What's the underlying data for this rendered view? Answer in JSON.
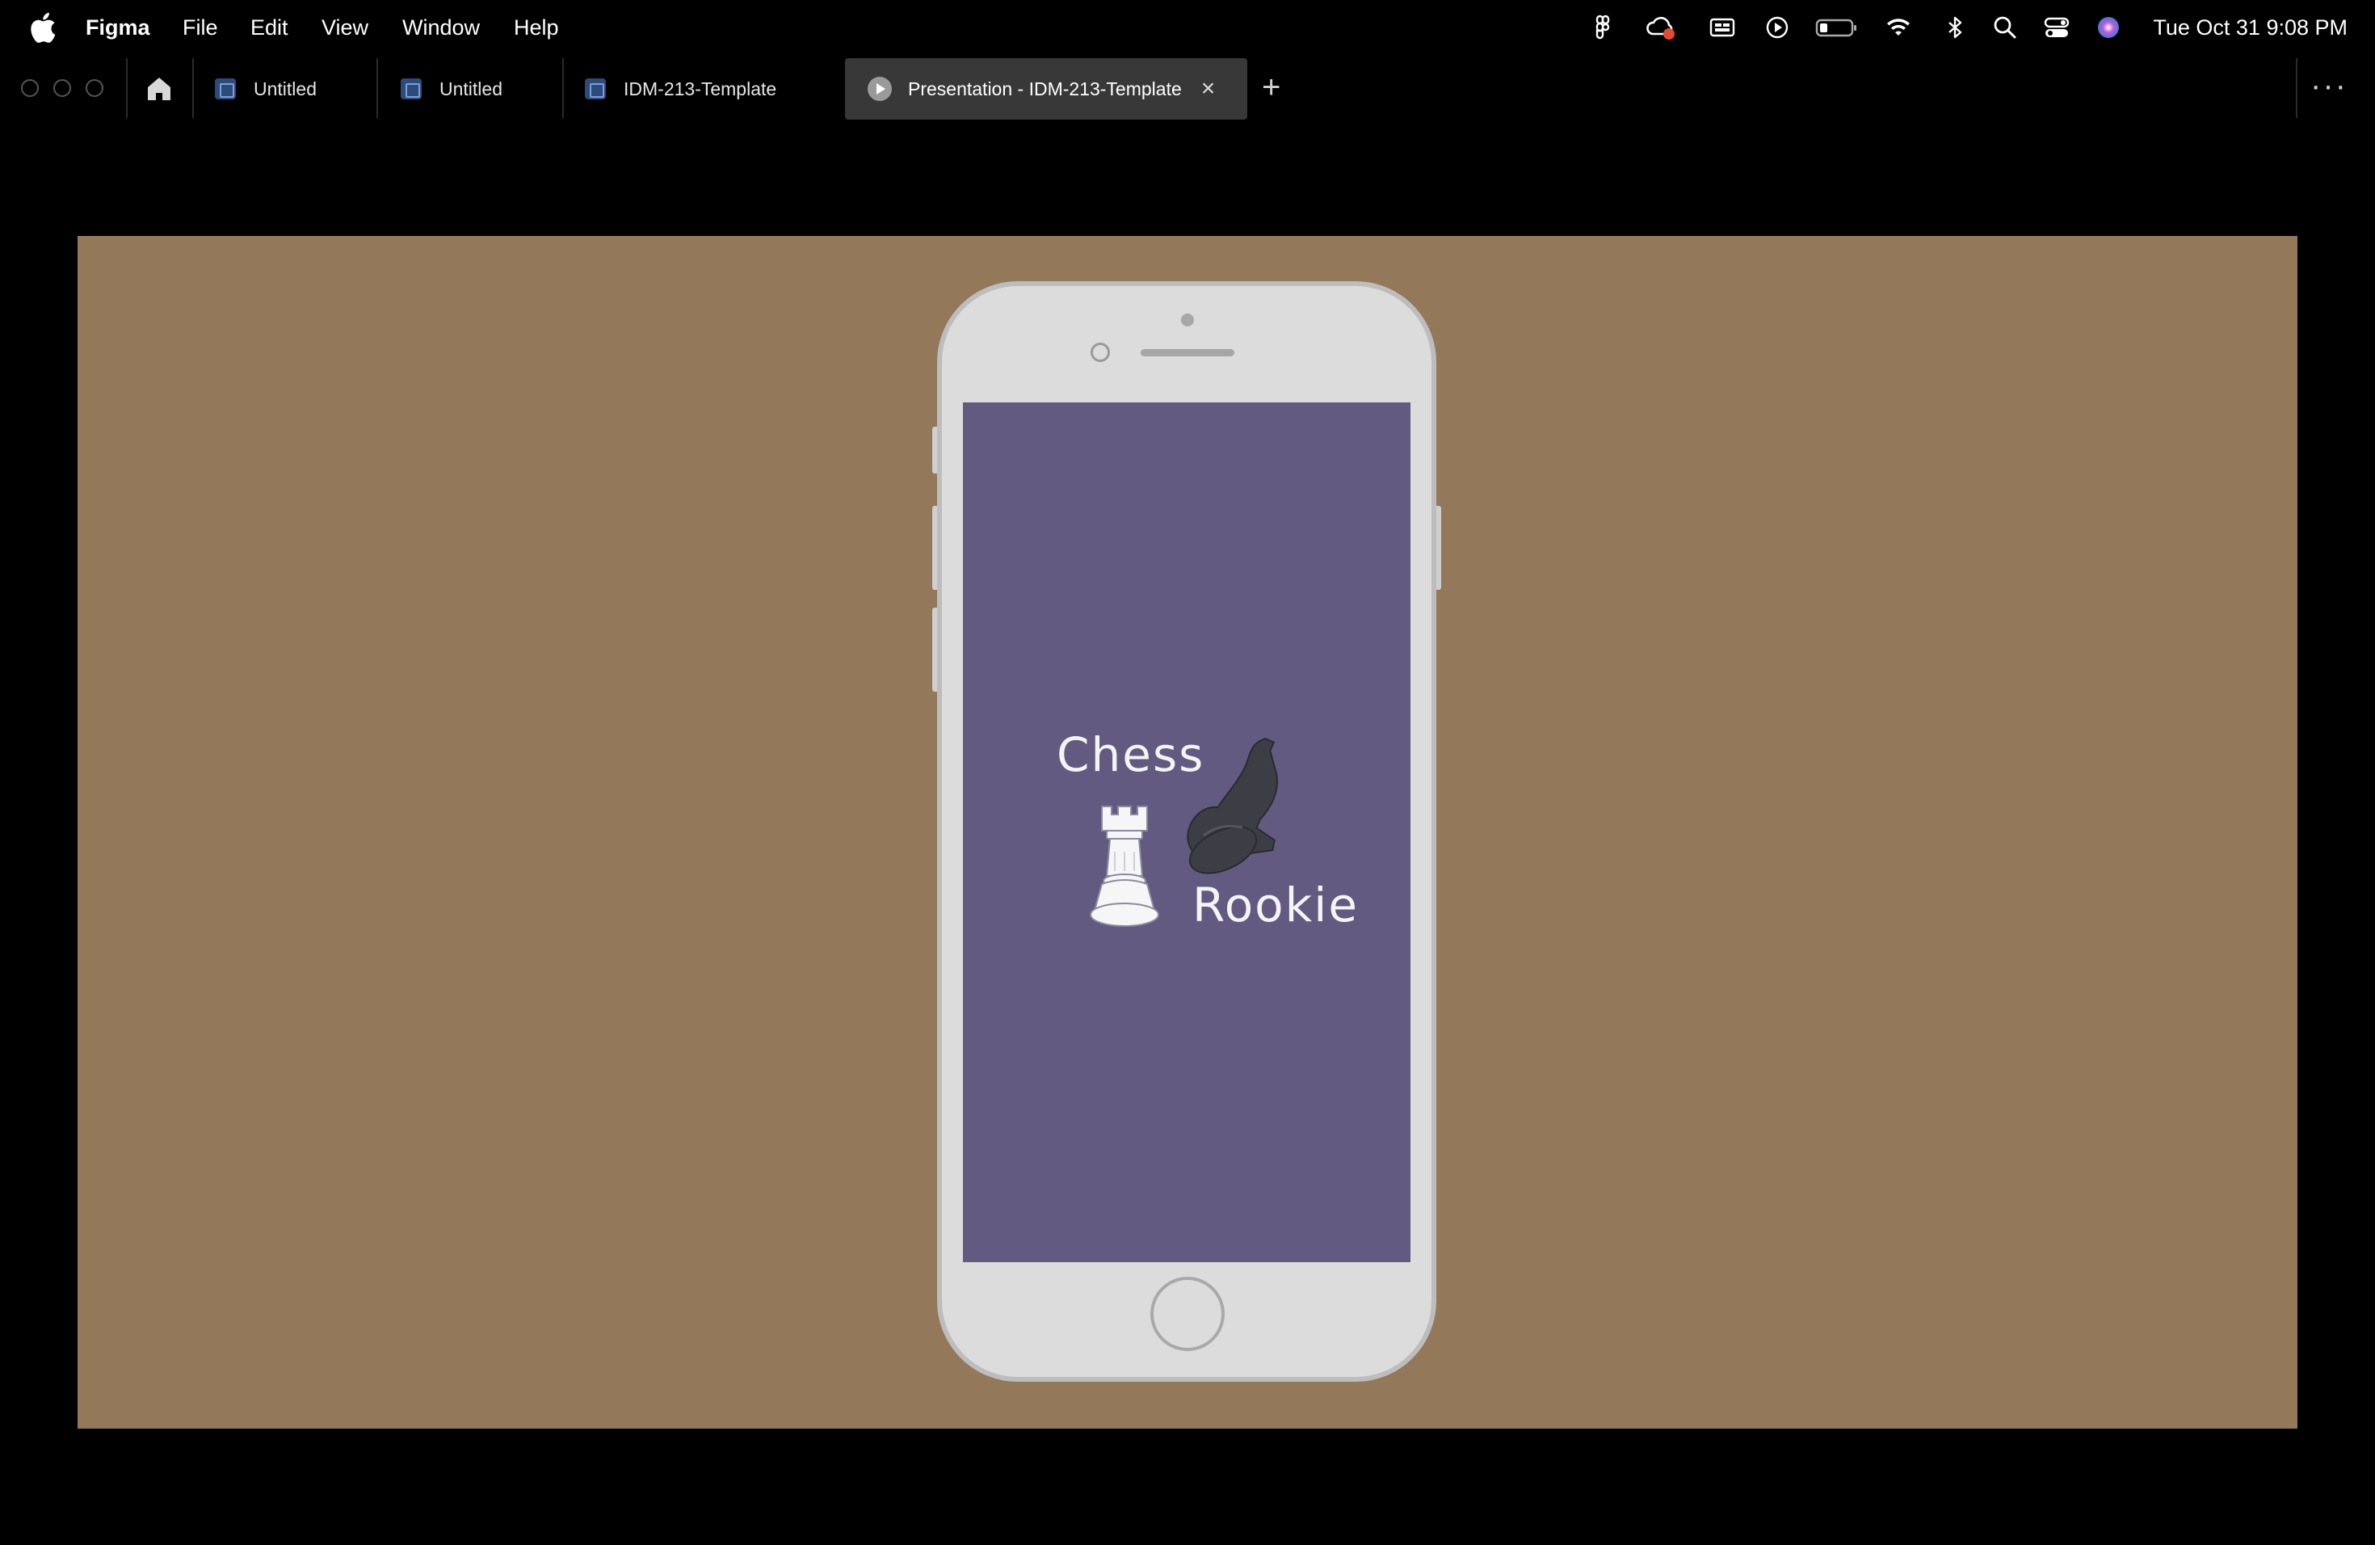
{
  "menubar": {
    "app_name": "Figma",
    "menus": [
      "File",
      "Edit",
      "View",
      "Window",
      "Help"
    ],
    "status_icons": [
      "figma-icon",
      "creative-cloud-icon",
      "screen-share-icon",
      "play-circle-icon",
      "battery-icon",
      "wifi-icon",
      "bluetooth-icon",
      "spotlight-search-icon",
      "control-center-icon",
      "siri-icon"
    ],
    "clock": "Tue Oct 31  9:08 PM"
  },
  "tabs": [
    {
      "label": "Untitled",
      "active": false
    },
    {
      "label": "Untitled",
      "active": false
    },
    {
      "label": "IDM-213-Template",
      "active": false
    },
    {
      "label": "Presentation - IDM-213-Template",
      "active": true
    }
  ],
  "canvas": {
    "background": "#94785a",
    "phone_screen_color": "#625a80",
    "logo": {
      "line1": "Chess",
      "line2": "Rookie"
    }
  },
  "colors": {
    "menubar_bg": "#000000",
    "active_tab_bg": "#383838"
  }
}
